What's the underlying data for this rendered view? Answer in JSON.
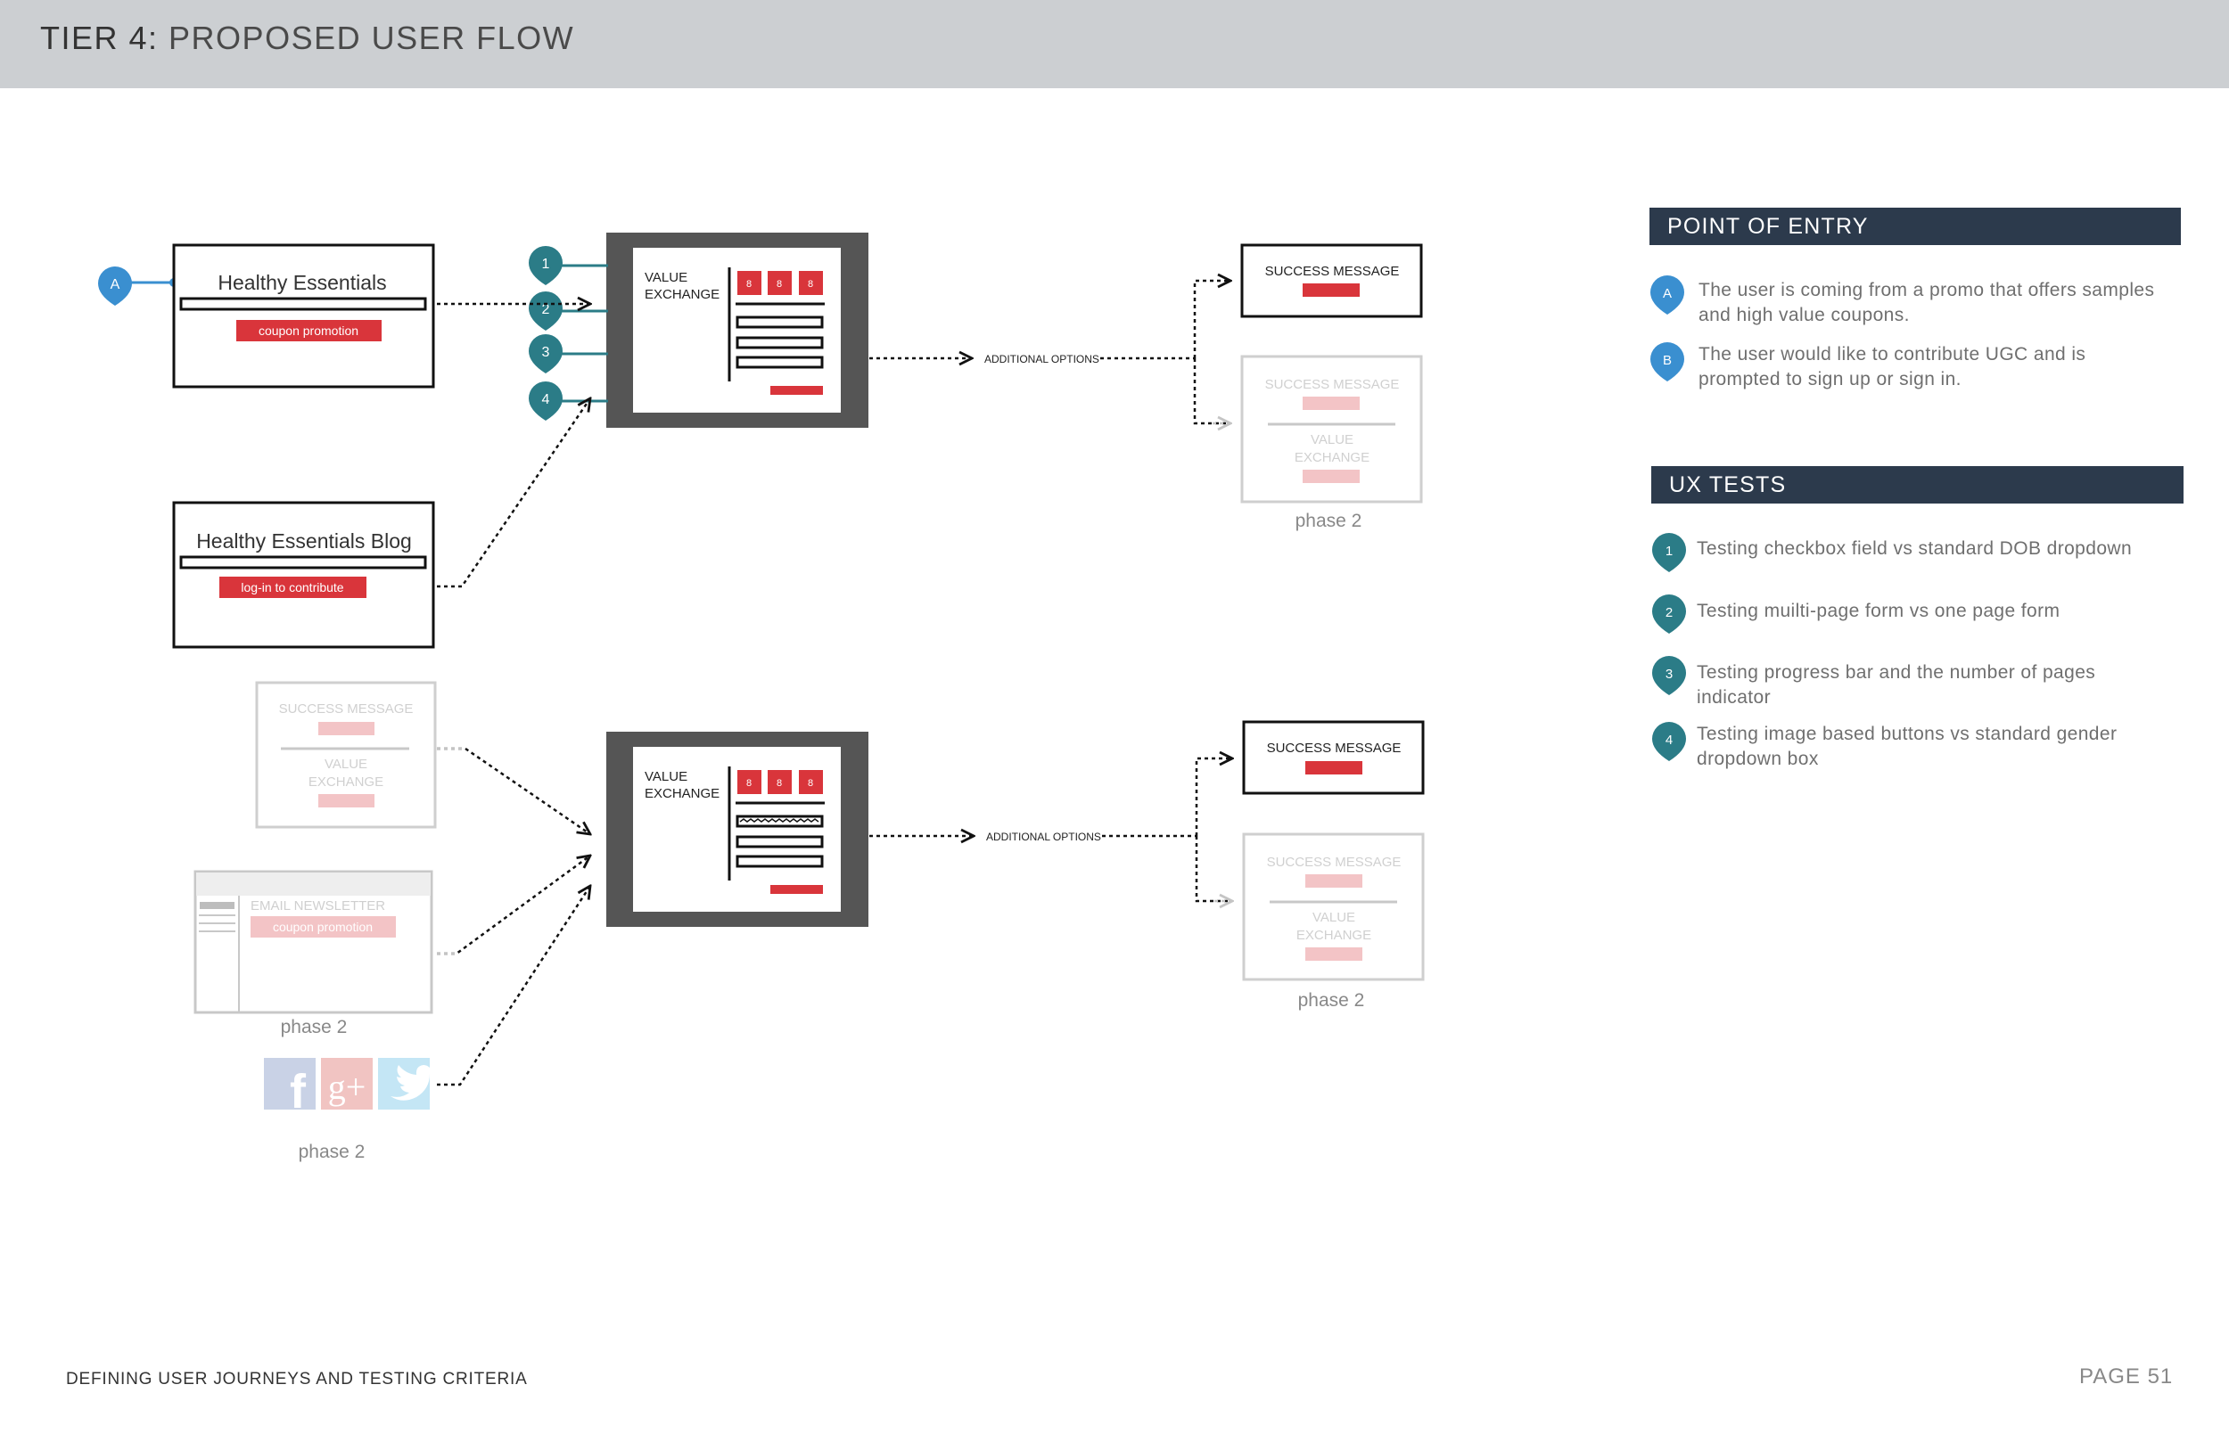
{
  "header": {
    "title_prefix": "TIER 4:",
    "title_rest": "PROPOSED USER FLOW"
  },
  "entry_points": {
    "healthy_essentials": {
      "title": "Healthy Essentials",
      "button": "coupon promotion",
      "marker": "A"
    },
    "blog": {
      "title": "Healthy Essentials Blog",
      "button": "log-in to contribute"
    },
    "ghost_success": {
      "title": "SUCCESS MESSAGE",
      "sub": [
        "VALUE",
        "EXCHANGE"
      ]
    },
    "email": {
      "title": "EMAIL NEWSLETTER",
      "button": "coupon promotion",
      "caption": "phase 2"
    },
    "social": {
      "icons": [
        "facebook-icon",
        "google-plus-icon",
        "twitter-icon"
      ],
      "glyphs": [
        "f",
        "g+"
      ],
      "caption": "phase 2"
    }
  },
  "value_exchange": {
    "label_line1": "VALUE",
    "label_line2": "EXCHANGE",
    "digit": "8"
  },
  "test_markers": [
    "1",
    "2",
    "3",
    "4"
  ],
  "additional_options": "ADDITIONAL OPTIONS",
  "success": {
    "title": "SUCCESS MESSAGE",
    "phase2_title": "SUCCESS MESSAGE",
    "phase2_sub": [
      "VALUE",
      "EXCHANGE"
    ],
    "caption": "phase 2"
  },
  "point_of_entry": {
    "heading": "POINT OF ENTRY",
    "items": [
      {
        "marker": "A",
        "line1": "The user is coming from a promo that offers samples",
        "line2": "and high value coupons."
      },
      {
        "marker": "B",
        "line1": "The user would like to contribute UGC and is",
        "line2": "prompted to sign up or sign in."
      }
    ]
  },
  "ux_tests": {
    "heading": "UX TESTS",
    "items": [
      {
        "marker": "1",
        "line1": "Testing checkbox field vs standard DOB dropdown",
        "line2": ""
      },
      {
        "marker": "2",
        "line1": "Testing muilti-page form vs one page form",
        "line2": ""
      },
      {
        "marker": "3",
        "line1": "Testing progress bar and the number of pages",
        "line2": "indicator"
      },
      {
        "marker": "4",
        "line1": "Testing image based buttons vs standard gender",
        "line2": "dropdown box"
      }
    ]
  },
  "colors": {
    "red": "#d9353b",
    "pale_red": "#f3c4c6",
    "teal": "#2b7c87",
    "blue": "#3a8fd0",
    "navy": "#2c3a4c",
    "dark_frame": "#555555"
  },
  "footer": {
    "left": "DEFINING USER JOURNEYS AND TESTING CRITERIA",
    "right": "PAGE 51"
  }
}
